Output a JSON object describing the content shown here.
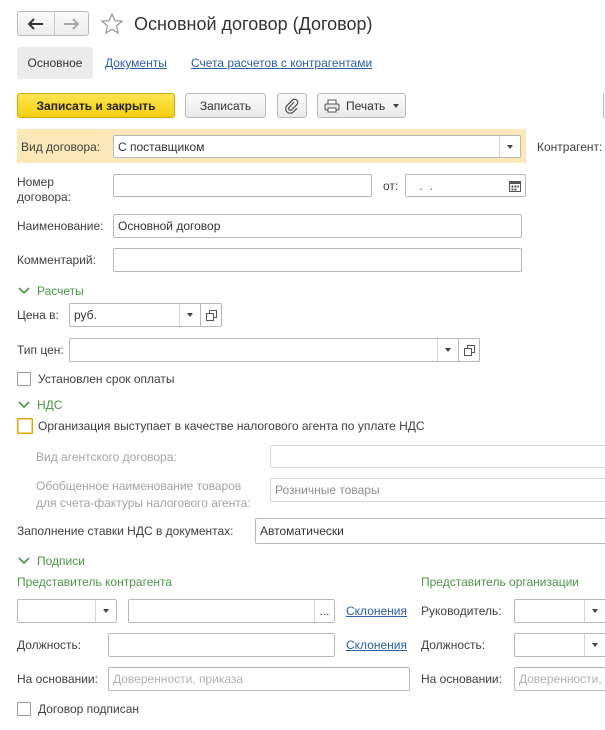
{
  "header": {
    "title": "Основной договор (Договор)"
  },
  "tabs": [
    {
      "label": "Основное",
      "active": true
    },
    {
      "label": "Документы",
      "active": false
    },
    {
      "label": "Счета расчетов с контрагентами",
      "active": false
    }
  ],
  "toolbar": {
    "save_close_label": "Записать и закрыть",
    "save_label": "Записать",
    "attach_icon": "paperclip-icon",
    "print_label": "Печать"
  },
  "contract_type": {
    "label": "Вид договора:",
    "value": "С поставщиком",
    "highlight_color": "#fbe7b7"
  },
  "counterparty": {
    "label": "Контрагент:"
  },
  "number": {
    "label_lines": [
      "Номер",
      "договора:"
    ],
    "value": ""
  },
  "date": {
    "label": "от:",
    "value": " .  . "
  },
  "name": {
    "label": "Наименование:",
    "value": "Основной договор"
  },
  "comment": {
    "label": "Комментарий:",
    "value": ""
  },
  "settlements": {
    "header": "Расчеты",
    "price_in": {
      "label": "Цена в:",
      "value": "руб."
    },
    "price_type": {
      "label": "Тип цен:",
      "value": ""
    },
    "payment_term_checkbox": {
      "label": "Установлен срок оплаты",
      "checked": false
    }
  },
  "vat": {
    "header": "НДС",
    "tax_agent_checkbox": {
      "label": "Организация выступает в качестве налогового агента по уплате НДС",
      "checked": false
    },
    "agent_contract_type": {
      "label": "Вид агентского договора:",
      "value": ""
    },
    "generic_goods_name": {
      "label_lines": [
        "Обобщенное наименование товаров",
        "для счета-фактуры налогового агента:"
      ],
      "value": "Розничные товары"
    },
    "rate_filling": {
      "label": "Заполнение ставки НДС в документах:",
      "value": "Автоматически"
    }
  },
  "signatures": {
    "header": "Подписи",
    "counterparty_rep": {
      "title": "Представитель контрагента",
      "kind_value": "",
      "person_value": "",
      "dots": "...",
      "declension_link": "Склонения",
      "position_label": "Должность:",
      "position_value": "",
      "position_declension_link": "Склонения",
      "basis_label": "На основании:",
      "basis_placeholder": "Доверенности, приказа"
    },
    "organization_rep": {
      "title": "Представитель организации",
      "head_label": "Руководитель:",
      "position_label": "Должность:",
      "basis_label": "На основании:",
      "basis_placeholder": "Доверенности, приказа"
    },
    "signed_checkbox": {
      "label": "Договор подписан",
      "checked": false
    }
  },
  "colors": {
    "accent_green": "#4a9645",
    "link_blue": "#2a5ea8",
    "primary_button": "#f3cf12"
  }
}
